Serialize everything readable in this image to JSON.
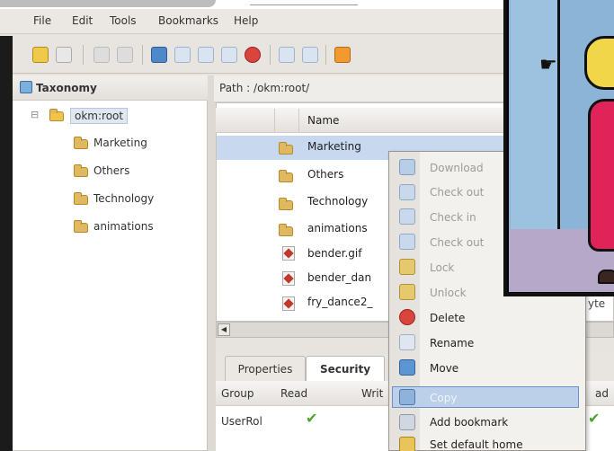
{
  "menubar": {
    "items": [
      "File",
      "Edit",
      "Tools",
      "Bookmarks",
      "Help"
    ]
  },
  "left_panel": {
    "title": "Taxonomy",
    "root": "okm:root",
    "children": [
      "Marketing",
      "Others",
      "Technology",
      "animations"
    ],
    "expander": "⊟"
  },
  "path_bar": {
    "label": "Path : /okm:root/"
  },
  "file_list": {
    "column_name": "Name",
    "rows": [
      {
        "name": "Marketing",
        "type": "folder"
      },
      {
        "name": "Others",
        "type": "folder"
      },
      {
        "name": "Technology",
        "type": "folder"
      },
      {
        "name": "animations",
        "type": "folder"
      },
      {
        "name": "bender.gif",
        "type": "gif"
      },
      {
        "name": "bender_dan",
        "type": "gif"
      },
      {
        "name": "fry_dance2_",
        "type": "gif"
      }
    ],
    "partial_text": "yte",
    "scroll_left": "◀"
  },
  "bottom_tabs": {
    "tabs": [
      "Properties",
      "Security"
    ],
    "active": "Security"
  },
  "security_grid": {
    "headers": [
      "Group",
      "Read",
      "Writ",
      "ad"
    ],
    "row": {
      "group": "UserRol"
    }
  },
  "context_menu": {
    "items": [
      {
        "label": "Download",
        "enabled": false
      },
      {
        "label": "Check out",
        "enabled": false
      },
      {
        "label": "Check in",
        "enabled": false
      },
      {
        "label": "Check out",
        "enabled": false
      },
      {
        "label": "Lock",
        "enabled": false
      },
      {
        "label": "Unlock",
        "enabled": false
      },
      {
        "label": "Delete",
        "enabled": true
      },
      {
        "label": "Rename",
        "enabled": true
      },
      {
        "label": "Move",
        "enabled": true
      },
      {
        "label": "Copy",
        "enabled": true,
        "highlighted": true
      },
      {
        "label": "Add bookmark",
        "enabled": true
      },
      {
        "label": "Set default home",
        "enabled": true
      }
    ]
  },
  "colors": {
    "selection": "#c7d8ef",
    "ctx_highlight": "#bcd0ea",
    "check_green": "#4aa52e",
    "delete_red": "#d9453d"
  }
}
